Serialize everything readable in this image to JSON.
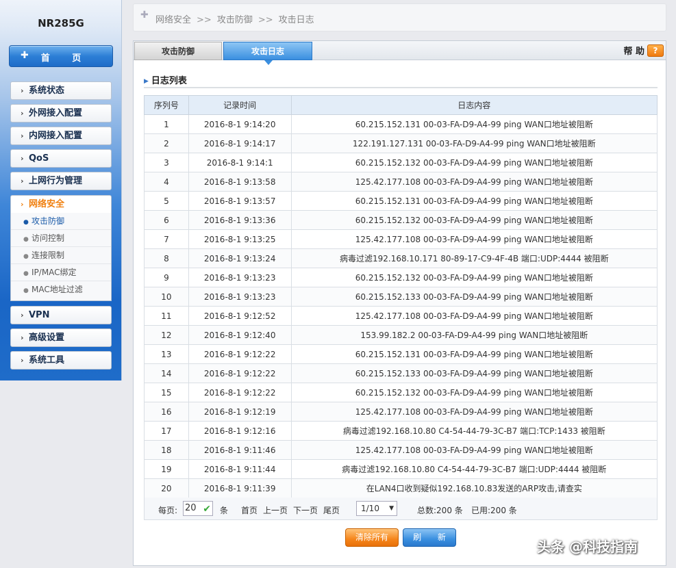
{
  "sidebar": {
    "model": "NR285G",
    "home_label": "首 页",
    "menu": [
      {
        "label": "系统状态"
      },
      {
        "label": "外网接入配置"
      },
      {
        "label": "内网接入配置"
      },
      {
        "label": "QoS"
      },
      {
        "label": "上网行为管理"
      },
      {
        "label": "网络安全"
      },
      {
        "label": "VPN"
      },
      {
        "label": "高级设置"
      },
      {
        "label": "系统工具"
      }
    ],
    "submenu": [
      {
        "label": "攻击防御"
      },
      {
        "label": "访问控制"
      },
      {
        "label": "连接限制"
      },
      {
        "label": "IP/MAC绑定"
      },
      {
        "label": "MAC地址过滤"
      }
    ]
  },
  "breadcrumb": {
    "items": [
      "网络安全",
      "攻击防御",
      "攻击日志"
    ],
    "separator": ">>"
  },
  "tabs": [
    {
      "label": "攻击防御"
    },
    {
      "label": "攻击日志"
    }
  ],
  "help": {
    "label": "帮 助",
    "icon": "?"
  },
  "section_title": "日志列表",
  "table": {
    "headers": [
      "序列号",
      "记录时间",
      "日志内容"
    ],
    "rows": [
      [
        "1",
        "2016-8-1 9:14:20",
        "60.215.152.131 00-03-FA-D9-A4-99 ping WAN口地址被阻断"
      ],
      [
        "2",
        "2016-8-1 9:14:17",
        "122.191.127.131 00-03-FA-D9-A4-99 ping WAN口地址被阻断"
      ],
      [
        "3",
        "2016-8-1 9:14:1",
        "60.215.152.132 00-03-FA-D9-A4-99 ping WAN口地址被阻断"
      ],
      [
        "4",
        "2016-8-1 9:13:58",
        "125.42.177.108 00-03-FA-D9-A4-99 ping WAN口地址被阻断"
      ],
      [
        "5",
        "2016-8-1 9:13:57",
        "60.215.152.131 00-03-FA-D9-A4-99 ping WAN口地址被阻断"
      ],
      [
        "6",
        "2016-8-1 9:13:36",
        "60.215.152.132 00-03-FA-D9-A4-99 ping WAN口地址被阻断"
      ],
      [
        "7",
        "2016-8-1 9:13:25",
        "125.42.177.108 00-03-FA-D9-A4-99 ping WAN口地址被阻断"
      ],
      [
        "8",
        "2016-8-1 9:13:24",
        "病毒过滤192.168.10.171 80-89-17-C9-4F-4B 端口:UDP:4444 被阻断"
      ],
      [
        "9",
        "2016-8-1 9:13:23",
        "60.215.152.132 00-03-FA-D9-A4-99 ping WAN口地址被阻断"
      ],
      [
        "10",
        "2016-8-1 9:13:23",
        "60.215.152.133 00-03-FA-D9-A4-99 ping WAN口地址被阻断"
      ],
      [
        "11",
        "2016-8-1 9:12:52",
        "125.42.177.108 00-03-FA-D9-A4-99 ping WAN口地址被阻断"
      ],
      [
        "12",
        "2016-8-1 9:12:40",
        "153.99.182.2 00-03-FA-D9-A4-99 ping WAN口地址被阻断"
      ],
      [
        "13",
        "2016-8-1 9:12:22",
        "60.215.152.131 00-03-FA-D9-A4-99 ping WAN口地址被阻断"
      ],
      [
        "14",
        "2016-8-1 9:12:22",
        "60.215.152.133 00-03-FA-D9-A4-99 ping WAN口地址被阻断"
      ],
      [
        "15",
        "2016-8-1 9:12:22",
        "60.215.152.132 00-03-FA-D9-A4-99 ping WAN口地址被阻断"
      ],
      [
        "16",
        "2016-8-1 9:12:19",
        "125.42.177.108 00-03-FA-D9-A4-99 ping WAN口地址被阻断"
      ],
      [
        "17",
        "2016-8-1 9:12:16",
        "病毒过滤192.168.10.80 C4-54-44-79-3C-B7 端口:TCP:1433 被阻断"
      ],
      [
        "18",
        "2016-8-1 9:11:46",
        "125.42.177.108 00-03-FA-D9-A4-99 ping WAN口地址被阻断"
      ],
      [
        "19",
        "2016-8-1 9:11:44",
        "病毒过滤192.168.10.80 C4-54-44-79-3C-B7 端口:UDP:4444 被阻断"
      ],
      [
        "20",
        "2016-8-1 9:11:39",
        "在LAN4口收到疑似192.168.10.83发送的ARP攻击,请查实"
      ]
    ]
  },
  "pager": {
    "per_page_label": "每页:",
    "per_page_value": "20",
    "unit": "条",
    "first": "首页",
    "prev": "上一页",
    "next": "下一页",
    "last": "尾页",
    "page_value": "1/10",
    "total": "总数:200 条",
    "used": "已用:200 条"
  },
  "buttons": {
    "clear_all": "清除所有",
    "refresh": "刷 新"
  },
  "watermark": "头条 @科技指南",
  "colors": {
    "accent_blue": "#3a8fe0",
    "accent_orange": "#f5851a",
    "active_menu": "#f08010"
  }
}
